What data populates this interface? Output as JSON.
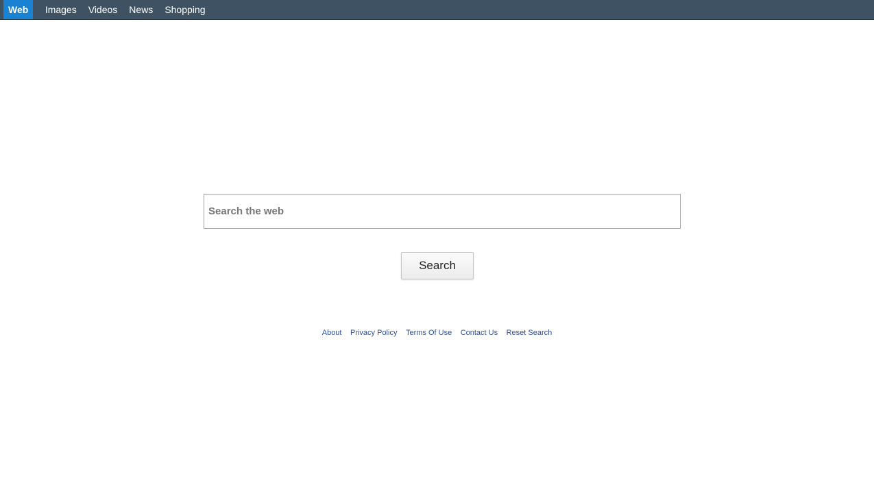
{
  "nav": {
    "tabs": [
      {
        "label": "Web",
        "active": true
      },
      {
        "label": "Images",
        "active": false
      },
      {
        "label": "Videos",
        "active": false
      },
      {
        "label": "News",
        "active": false
      },
      {
        "label": "Shopping",
        "active": false
      }
    ]
  },
  "search": {
    "placeholder": "Search the web",
    "value": "",
    "button_label": "Search"
  },
  "footer": {
    "links": [
      "About",
      "Privacy Policy",
      "Terms Of Use",
      "Contact Us",
      "Reset Search"
    ]
  },
  "colors": {
    "topbar": "#3e5263",
    "active_tab": "#1a82d2",
    "link": "#2d4f9a"
  }
}
